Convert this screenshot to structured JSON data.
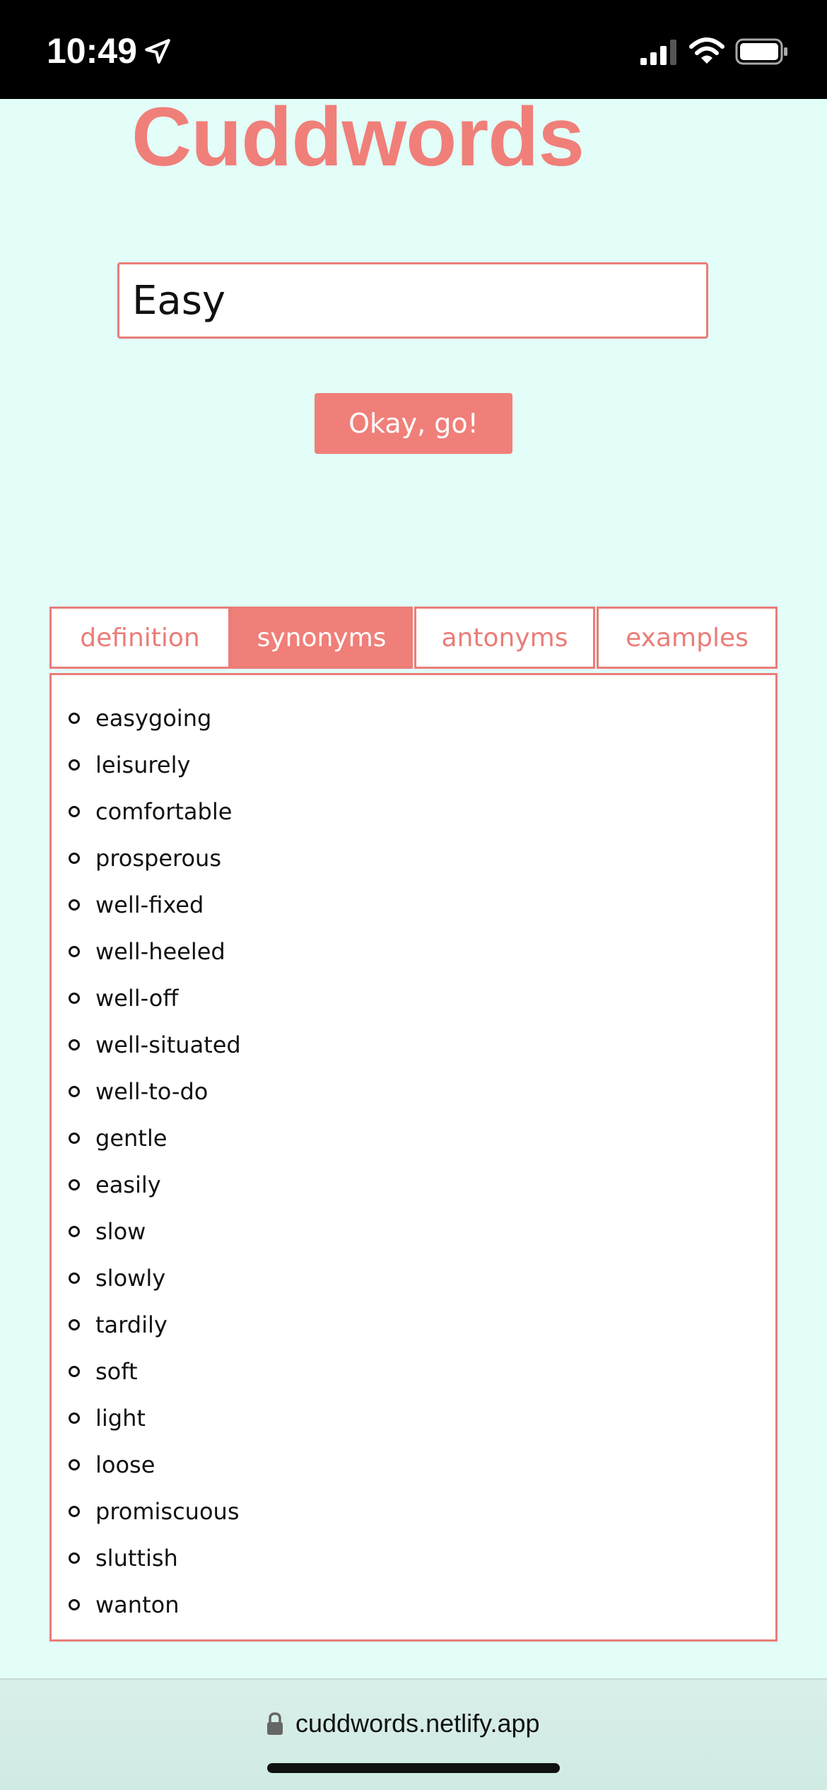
{
  "status_bar": {
    "time": "10:49",
    "icons": [
      "location-arrow-icon",
      "signal-icon",
      "wifi-icon",
      "battery-icon"
    ]
  },
  "app": {
    "title": "Cuddwords"
  },
  "search": {
    "value": "Easy",
    "button_label": "Okay, go!"
  },
  "tabs": [
    {
      "label": "definition",
      "active": false
    },
    {
      "label": "synonyms",
      "active": true
    },
    {
      "label": "antonyms",
      "active": false
    },
    {
      "label": "examples",
      "active": false
    }
  ],
  "synonyms": [
    "easygoing",
    "leisurely",
    "comfortable",
    "prosperous",
    "well-fixed",
    "well-heeled",
    "well-off",
    "well-situated",
    "well-to-do",
    "gentle",
    "easily",
    "slow",
    "slowly",
    "tardily",
    "soft",
    "light",
    "loose",
    "promiscuous",
    "sluttish",
    "wanton"
  ],
  "browser": {
    "url": "cuddwords.netlify.app",
    "lock_icon": "lock-icon"
  },
  "colors": {
    "accent": "#f07f79",
    "background": "#e3fdf8"
  }
}
